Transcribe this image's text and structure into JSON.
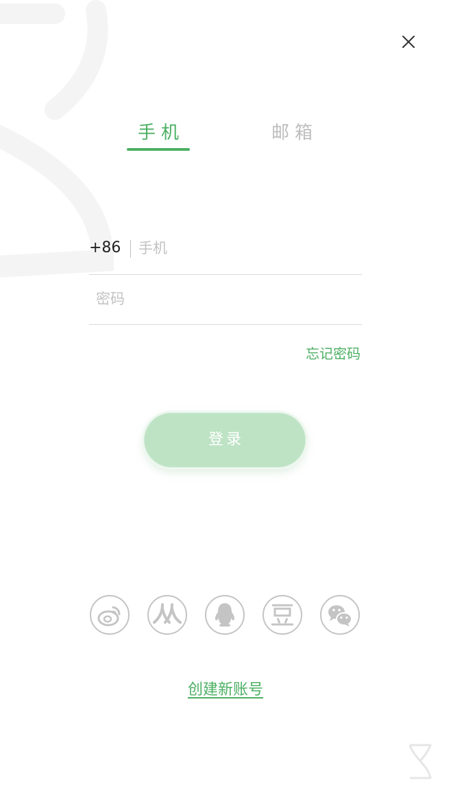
{
  "tabs": {
    "phone_label": "手机",
    "email_label": "邮箱",
    "active": "phone"
  },
  "form": {
    "country_code": "+86",
    "phone_placeholder": "手机",
    "phone_value": "",
    "password_placeholder": "密码",
    "password_value": "",
    "forgot_password_label": "忘记密码"
  },
  "login_button": {
    "label": "登录"
  },
  "social_logins": [
    {
      "name": "weibo",
      "icon": "weibo-icon"
    },
    {
      "name": "renren",
      "icon": "renren-icon"
    },
    {
      "name": "qq",
      "icon": "qq-icon"
    },
    {
      "name": "douban",
      "icon": "douban-icon",
      "glyph": "豆"
    },
    {
      "name": "wechat",
      "icon": "wechat-icon"
    }
  ],
  "create_account_label": "创建新账号",
  "colors": {
    "accent": "#4caf63",
    "button_fill": "#bde3c4",
    "placeholder": "#c2c2c2",
    "inactive_tab": "#bdbdbd",
    "social_outline": "#c4c4c4",
    "divider": "#d9d9d9"
  }
}
